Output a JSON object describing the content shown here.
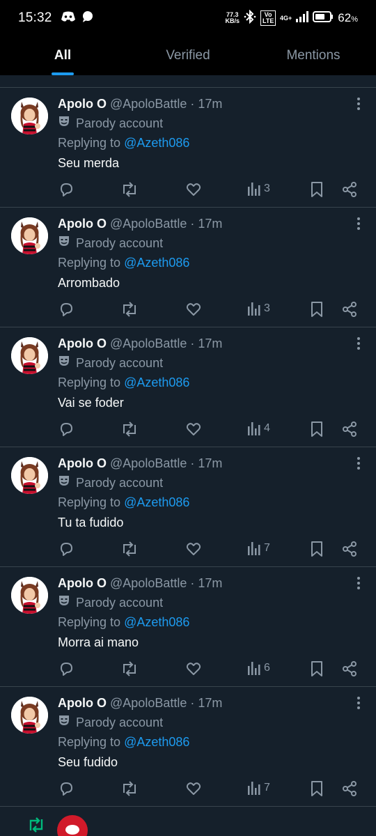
{
  "status_bar": {
    "time": "15:32",
    "speed_value": "77.3",
    "speed_unit": "KB/s",
    "volte": "Vo LTE",
    "network": "4G+",
    "battery_percent": "62",
    "percent_sign": "%",
    "icons": [
      "discord-icon",
      "chat-bubble-icon",
      "bluetooth-icon",
      "signal-icon",
      "battery-icon"
    ]
  },
  "tabs": [
    {
      "label": "All",
      "active": true
    },
    {
      "label": "Verified",
      "active": false
    },
    {
      "label": "Mentions",
      "active": false
    }
  ],
  "tweets": [
    {
      "name": "Apolo O",
      "handle": "@ApoloBattle",
      "dot": "·",
      "time": "17m",
      "badge": "Parody account",
      "replying_prefix": "Replying to",
      "replying_to": "@Azeth086",
      "text": "Seu merda",
      "views": "3"
    },
    {
      "name": "Apolo O",
      "handle": "@ApoloBattle",
      "dot": "·",
      "time": "17m",
      "badge": "Parody account",
      "replying_prefix": "Replying to",
      "replying_to": "@Azeth086",
      "text": "Arrombado",
      "views": "3"
    },
    {
      "name": "Apolo O",
      "handle": "@ApoloBattle",
      "dot": "·",
      "time": "17m",
      "badge": "Parody account",
      "replying_prefix": "Replying to",
      "replying_to": "@Azeth086",
      "text": "Vai se foder",
      "views": "4"
    },
    {
      "name": "Apolo O",
      "handle": "@ApoloBattle",
      "dot": "·",
      "time": "17m",
      "badge": "Parody account",
      "replying_prefix": "Replying to",
      "replying_to": "@Azeth086",
      "text": "Tu ta fudido",
      "views": "7"
    },
    {
      "name": "Apolo O",
      "handle": "@ApoloBattle",
      "dot": "·",
      "time": "17m",
      "badge": "Parody account",
      "replying_prefix": "Replying to",
      "replying_to": "@Azeth086",
      "text": "Morra ai mano",
      "views": "6"
    },
    {
      "name": "Apolo O",
      "handle": "@ApoloBattle",
      "dot": "·",
      "time": "17m",
      "badge": "Parody account",
      "replying_prefix": "Replying to",
      "replying_to": "@Azeth086",
      "text": "Seu fudido",
      "views": "7"
    }
  ],
  "colors": {
    "background": "#15202b",
    "accent": "#1d9bf0",
    "muted": "#8b98a5",
    "divider": "#38444d",
    "repost_green": "#00ba7c"
  }
}
